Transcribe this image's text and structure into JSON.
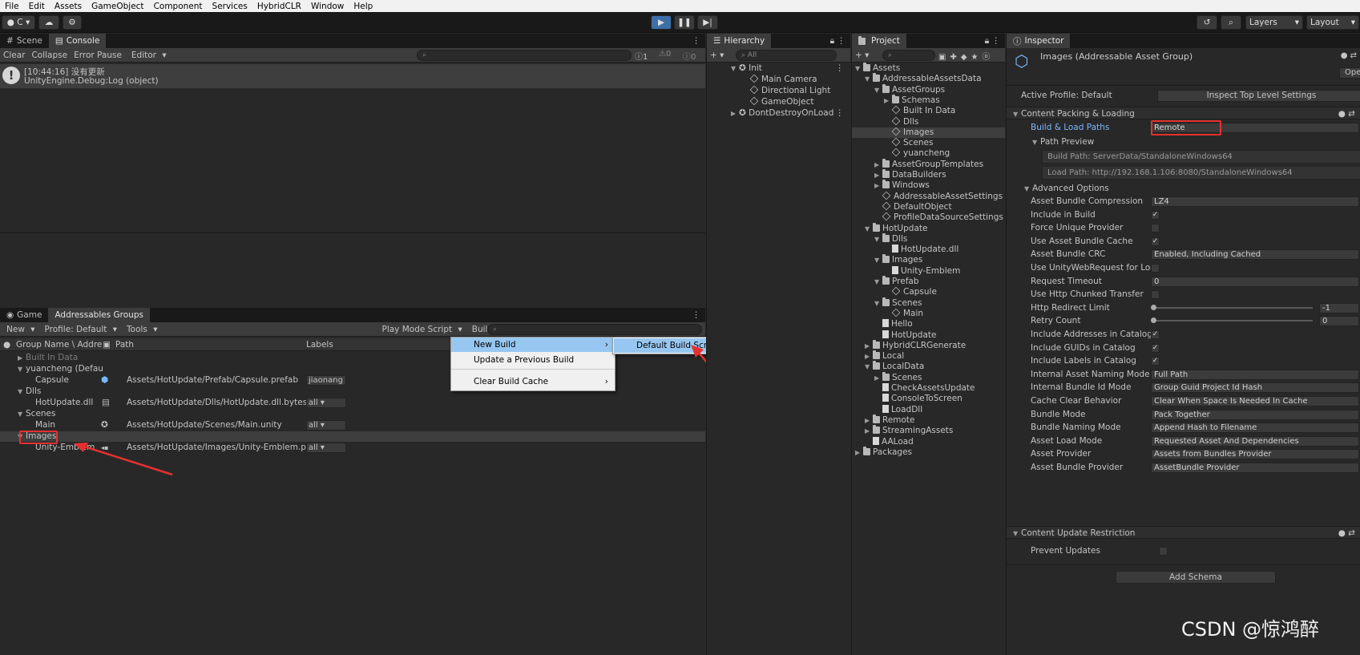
{
  "menubar": [
    "File",
    "Edit",
    "Assets",
    "GameObject",
    "Component",
    "Services",
    "HybridCLR",
    "Window",
    "Help"
  ],
  "toolbar": {
    "account": "C",
    "layers": "Layers",
    "layout": "Layout"
  },
  "console": {
    "tabs": [
      "Scene",
      "Console"
    ],
    "buttons": [
      "Clear",
      "Collapse",
      "Error Pause",
      "Editor"
    ],
    "counts": [
      "1",
      "0",
      "0"
    ],
    "log_line1": "[10:44:16] 没有更新",
    "log_line2": "UnityEngine.Debug:Log (object)"
  },
  "addr": {
    "tabs": [
      "Game",
      "Addressables Groups"
    ],
    "toolbar": {
      "new": "New",
      "profile": "Profile: Default",
      "tools": "Tools",
      "play_mode": "Play Mode Script",
      "build": "Build"
    },
    "columns": {
      "name": "Group Name \\ Addre",
      "path": "Path",
      "labels": "Labels"
    },
    "rows": [
      {
        "name": "Built In Data",
        "path": "",
        "label": ""
      },
      {
        "name": "yuancheng (Defau",
        "path": "",
        "label": ""
      },
      {
        "name": "Capsule",
        "path": "Assets/HotUpdate/Prefab/Capsule.prefab",
        "label": "jiaonang"
      },
      {
        "name": "Dlls",
        "path": "",
        "label": ""
      },
      {
        "name": "HotUpdate.dll",
        "path": "Assets/HotUpdate/Dlls/HotUpdate.dll.bytes",
        "label": "all"
      },
      {
        "name": "Scenes",
        "path": "",
        "label": ""
      },
      {
        "name": "Main",
        "path": "Assets/HotUpdate/Scenes/Main.unity",
        "label": "all"
      },
      {
        "name": "Images",
        "path": "",
        "label": ""
      },
      {
        "name": "Unity-Emblem",
        "path": "Assets/HotUpdate/Images/Unity-Emblem.pr",
        "label": "all"
      }
    ]
  },
  "build_menu": {
    "items": [
      "New Build",
      "Update a Previous Build",
      "Clear Build Cache"
    ],
    "submenu": "Default Build Script"
  },
  "hierarchy": {
    "tab": "Hierarchy",
    "search": "All",
    "rows": [
      "Init",
      "Main Camera",
      "Directional Light",
      "GameObject",
      "DontDestroyOnLoad"
    ]
  },
  "project": {
    "tab": "Project",
    "rows": [
      "Assets",
      "AddressableAssetsData",
      "AssetGroups",
      "Schemas",
      "Built In Data",
      "Dlls",
      "Images",
      "Scenes",
      "yuancheng",
      "AssetGroupTemplates",
      "DataBuilders",
      "Windows",
      "AddressableAssetSettings",
      "DefaultObject",
      "ProfileDataSourceSettings",
      "HotUpdate",
      "Dlls",
      "HotUpdate.dll",
      "Images",
      "Unity-Emblem",
      "Prefab",
      "Capsule",
      "Scenes",
      "Main",
      "Hello",
      "HotUpdate",
      "HybridCLRGenerate",
      "Local",
      "LocalData",
      "Scenes",
      "CheckAssetsUpdate",
      "ConsoleToScreen",
      "LoadDll",
      "Remote",
      "StreamingAssets",
      "AALoad",
      "Packages"
    ]
  },
  "inspector": {
    "tab": "Inspector",
    "title": "Images (Addressable Asset Group)",
    "open": "Open",
    "active_profile": "Active Profile: Default",
    "inspect_btn": "Inspect Top Level Settings",
    "sec_content": "Content Packing & Loading",
    "build_load_label": "Build & Load Paths",
    "build_load_value": "Remote",
    "path_preview": "Path Preview",
    "build_path": "Build Path: ServerData/StandaloneWindows64",
    "load_path": "Load Path: http://192.168.1.106:8080/StandaloneWindows64",
    "advanced": "Advanced Options",
    "fields": [
      {
        "label": "Asset Bundle Compression",
        "type": "dd",
        "value": "LZ4"
      },
      {
        "label": "Include in Build",
        "type": "chk",
        "value": "✓"
      },
      {
        "label": "Force Unique Provider",
        "type": "chk",
        "value": ""
      },
      {
        "label": "Use Asset Bundle Cache",
        "type": "chk",
        "value": "✓"
      },
      {
        "label": "Asset Bundle CRC",
        "type": "dd",
        "value": "Enabled, Including Cached"
      },
      {
        "label": "Use UnityWebRequest for Loca",
        "type": "chk",
        "value": ""
      },
      {
        "label": "Request Timeout",
        "type": "txt",
        "value": "0"
      },
      {
        "label": "Use Http Chunked Transfer",
        "type": "chk",
        "value": ""
      },
      {
        "label": "Http Redirect Limit",
        "type": "slider",
        "value": "-1"
      },
      {
        "label": "Retry Count",
        "type": "slider",
        "value": "0"
      },
      {
        "label": "Include Addresses in Catalog",
        "type": "chk",
        "value": "✓"
      },
      {
        "label": "Include GUIDs in Catalog",
        "type": "chk",
        "value": "✓"
      },
      {
        "label": "Include Labels in Catalog",
        "type": "chk",
        "value": "✓"
      },
      {
        "label": "Internal Asset Naming Mode",
        "type": "dd",
        "value": "Full Path"
      },
      {
        "label": "Internal Bundle Id Mode",
        "type": "dd",
        "value": "Group Guid Project Id Hash"
      },
      {
        "label": "Cache Clear Behavior",
        "type": "dd",
        "value": "Clear When Space Is Needed In Cache"
      },
      {
        "label": "Bundle Mode",
        "type": "dd",
        "value": "Pack Together"
      },
      {
        "label": "Bundle Naming Mode",
        "type": "dd",
        "value": "Append Hash to Filename"
      },
      {
        "label": "Asset Load Mode",
        "type": "dd",
        "value": "Requested Asset And Dependencies"
      },
      {
        "label": "Asset Provider",
        "type": "dd",
        "value": "Assets from Bundles Provider"
      },
      {
        "label": "Asset Bundle Provider",
        "type": "dd",
        "value": "AssetBundle Provider"
      }
    ],
    "sec_update": "Content Update Restriction",
    "prevent_updates": "Prevent Updates",
    "add_schema": "Add Schema"
  },
  "watermark": "CSDN @惊鸿醉",
  "colors": {
    "accent": "#4a8fd8",
    "red": "#e53030",
    "highlight": "#97c7f0"
  }
}
